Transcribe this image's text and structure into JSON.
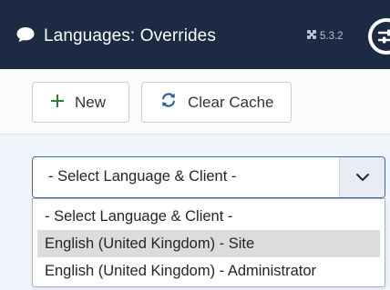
{
  "header": {
    "title": "Languages: Overrides",
    "version": "5.3.2"
  },
  "toolbar": {
    "new_label": "New",
    "clear_cache_label": "Clear Cache"
  },
  "filter": {
    "selected": "- Select Language & Client -",
    "options": [
      "- Select Language & Client -",
      "English (United Kingdom) - Site",
      "English (United Kingdom) - Administrator"
    ],
    "highlighted_index": 1
  },
  "colors": {
    "header_bg": "#1c2a43",
    "accent_green": "#2f7d32",
    "accent_blue": "#2c5e9e"
  }
}
